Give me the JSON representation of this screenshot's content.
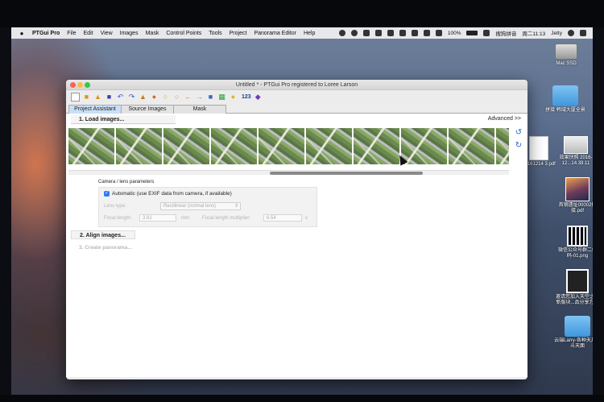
{
  "menubar": {
    "app_name": "PTGui Pro",
    "items": [
      "File",
      "Edit",
      "View",
      "Images",
      "Mask",
      "Control Points",
      "Tools",
      "Project",
      "Panorama Editor",
      "Help"
    ],
    "status": {
      "battery": "100%",
      "input_method": "搜狗拼音",
      "datetime": "周二11:13",
      "user": "Jetty"
    }
  },
  "desktop": {
    "items": [
      {
        "label": "Mac SSD"
      },
      {
        "label": "拼接 韩域大厦全景"
      },
      {
        "label": "20161214 3.pdf"
      },
      {
        "label": "效果快照 2016-12...14.39.11"
      },
      {
        "label": "首钢遗址00002拼接.pdf"
      },
      {
        "label": "微信公众号群二维码-01.png"
      },
      {
        "label": "邀请您加入天空之城 新版块...品分享方式"
      },
      {
        "label": "云端Larry-各种天儿的斗天面"
      }
    ]
  },
  "window": {
    "title": "Untitled * - PTGui Pro registered to Loree Larson",
    "toolbar_number": "123",
    "tabs": [
      "Project Assistant",
      "Source Images",
      "Mask"
    ],
    "active_tab": "Project Assistant"
  },
  "assistant": {
    "step1": "1. Load images...",
    "advanced": "Advanced >>",
    "step2": "2. Align images...",
    "step3": "3. Create panorama..."
  },
  "camera": {
    "group_label": "Camera / lens parameters",
    "exif_label": "Automatic (use EXIF data from camera, if available)",
    "lens_type_label": "Lens type:",
    "lens_type_value": "Rectilinear (normal lens)",
    "focal_length_label": "Focal length:",
    "focal_length_value": "3.61",
    "focal_unit": "mm",
    "multiplier_label": "Focal length multiplier:",
    "multiplier_value": "6.54",
    "multiplier_unit": "x"
  }
}
